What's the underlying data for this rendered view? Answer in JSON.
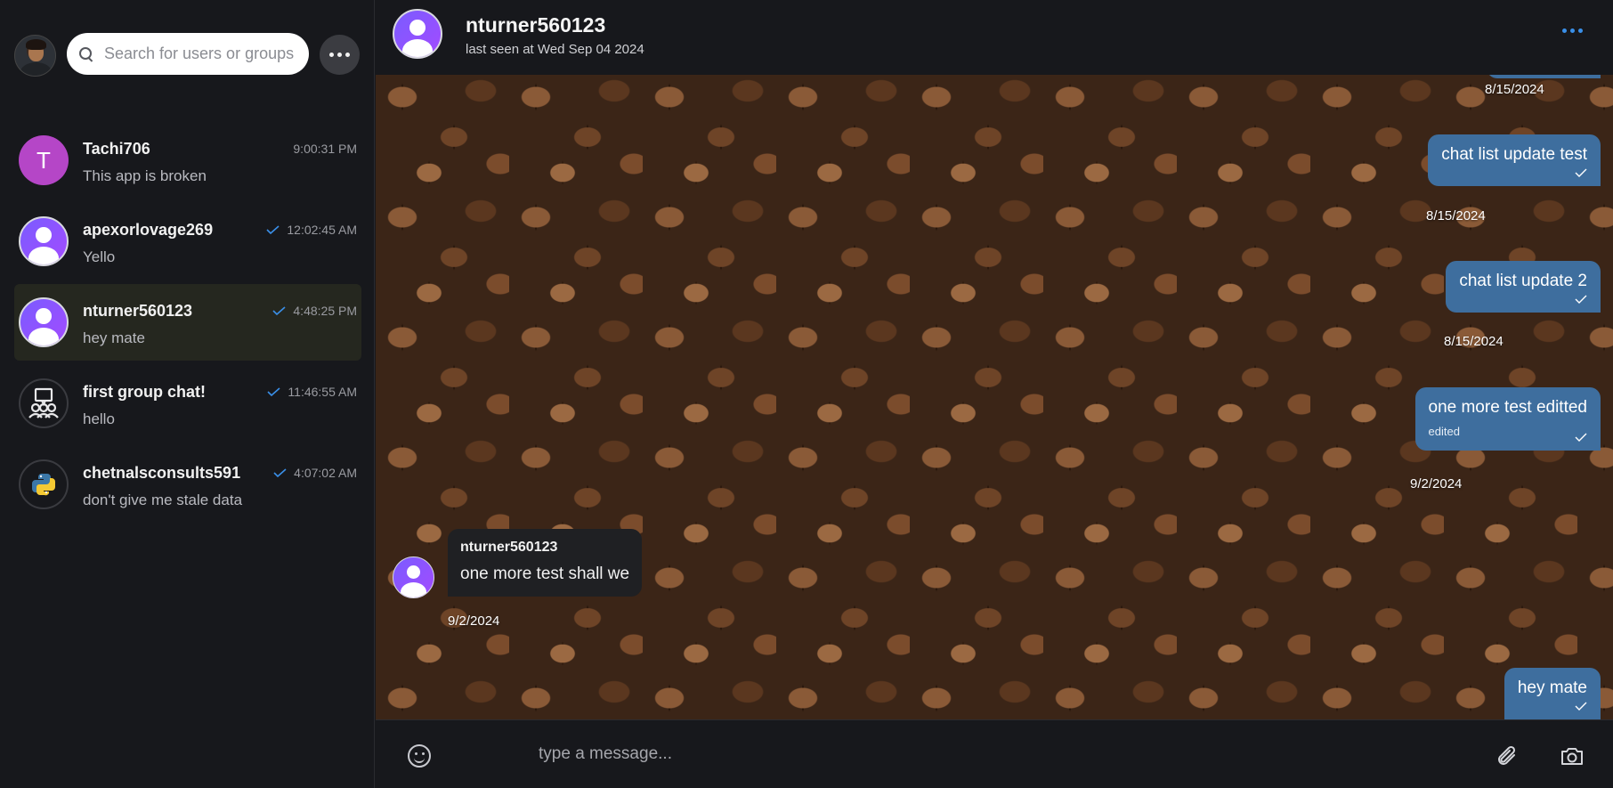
{
  "sidebar": {
    "search": {
      "placeholder": "Search for users or groups"
    },
    "chats": [
      {
        "name": "Tachi706",
        "time": "9:00:31 PM",
        "last": "This app is broken",
        "avatar": "letter",
        "letter": "T",
        "read": false
      },
      {
        "name": "apexorlovage269",
        "time": "12:02:45 AM",
        "last": "Yello",
        "avatar": "user",
        "read": true
      },
      {
        "name": "nturner560123",
        "time": "4:48:25 PM",
        "last": "hey mate",
        "avatar": "user",
        "read": true,
        "active": true
      },
      {
        "name": "first group chat!",
        "time": "11:46:55 AM",
        "last": "hello",
        "avatar": "group-icon",
        "read": true
      },
      {
        "name": "chetnalsconsults591",
        "time": "4:07:02 AM",
        "last": "don't give me stale data",
        "avatar": "python-icon",
        "read": true
      }
    ]
  },
  "header": {
    "name": "nturner560123",
    "status": "last seen at Wed Sep 04 2024"
  },
  "messages": {
    "top_partial_date": "8/15/2024",
    "items": [
      {
        "dir": "out",
        "text": "chat list update test",
        "date": "8/15/2024"
      },
      {
        "dir": "out",
        "text": "chat list update 2",
        "date": "8/15/2024"
      },
      {
        "dir": "out",
        "text": "one more test editted",
        "edited": "edited",
        "date": "9/2/2024"
      },
      {
        "dir": "in",
        "author": "nturner560123",
        "text": "one more test shall we",
        "date": "9/2/2024"
      },
      {
        "dir": "out",
        "text": "hey mate",
        "date": ""
      }
    ]
  },
  "composer": {
    "placeholder": "type a message..."
  },
  "colors": {
    "accent": "#3a8fe8",
    "bubble_out": "#3e6e9e",
    "bubble_in": "#1f2023",
    "active_row": "#25271f"
  }
}
